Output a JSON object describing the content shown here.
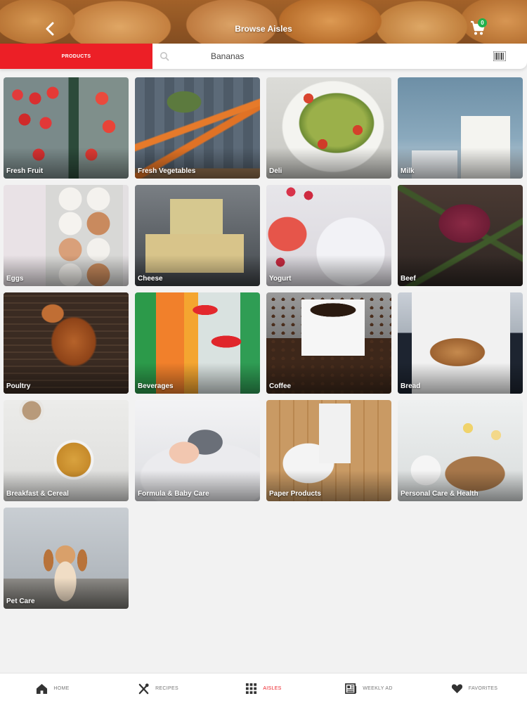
{
  "header": {
    "title": "Browse Aisles",
    "back_icon": "chevron-left-icon",
    "cart_icon": "cart-icon",
    "cart_count": "0"
  },
  "search": {
    "mode_tab": "PRODUCTS",
    "value": "Bananas",
    "placeholder": "",
    "search_icon": "search-icon",
    "barcode_icon": "barcode-icon"
  },
  "aisles": [
    {
      "label": "Fresh Fruit",
      "art": "art-fruit"
    },
    {
      "label": "Fresh Vegetables",
      "art": "art-veg"
    },
    {
      "label": "Deli",
      "art": "art-deli"
    },
    {
      "label": "Milk",
      "art": "art-milk"
    },
    {
      "label": "Eggs",
      "art": "art-eggs"
    },
    {
      "label": "Cheese",
      "art": "art-cheese"
    },
    {
      "label": "Yogurt",
      "art": "art-yogurt"
    },
    {
      "label": "Beef",
      "art": "art-beef"
    },
    {
      "label": "Poultry",
      "art": "art-poultry"
    },
    {
      "label": "Beverages",
      "art": "art-bev"
    },
    {
      "label": "Coffee",
      "art": "art-coffee"
    },
    {
      "label": "Bread",
      "art": "art-bread"
    },
    {
      "label": "Breakfast & Cereal",
      "art": "art-cereal"
    },
    {
      "label": "Formula & Baby Care",
      "art": "art-baby"
    },
    {
      "label": "Paper Products",
      "art": "art-paper"
    },
    {
      "label": "Personal Care & Health",
      "art": "art-personal"
    },
    {
      "label": "Pet Care",
      "art": "art-pet"
    }
  ],
  "bottom_nav": {
    "items": [
      {
        "label": "HOME",
        "icon": "home-icon"
      },
      {
        "label": "RECIPES",
        "icon": "utensils-icon"
      },
      {
        "label": "AISLES",
        "icon": "grid-icon",
        "active": true
      },
      {
        "label": "WEEKLY AD",
        "icon": "newspaper-icon"
      },
      {
        "label": "FAVORITES",
        "icon": "heart-icon"
      }
    ]
  },
  "colors": {
    "accent": "#ec1f26",
    "badge": "#22b14c",
    "nav_inactive": "#777777"
  }
}
